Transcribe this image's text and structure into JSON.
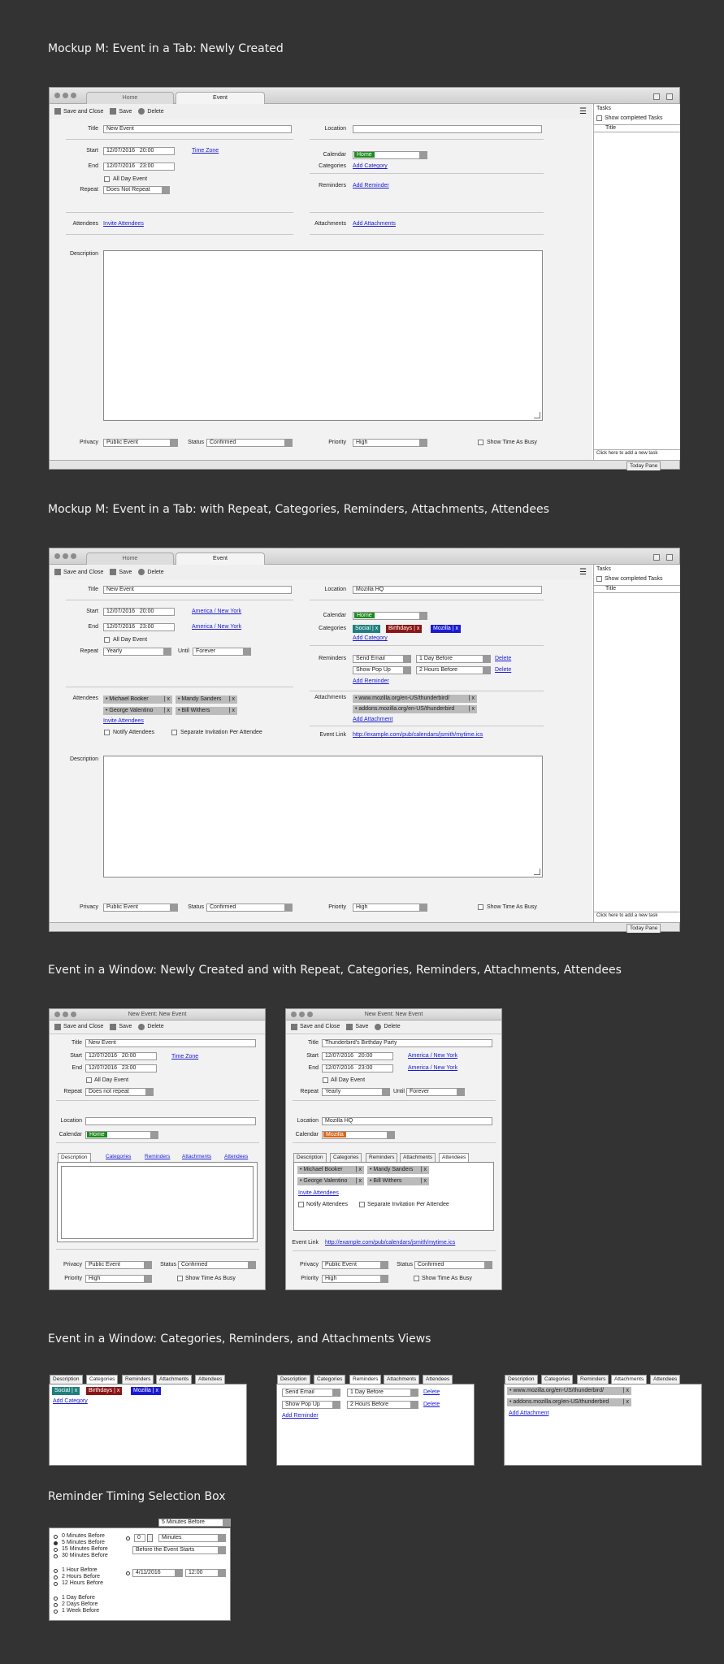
{
  "headings": [
    "Mockup M:  Event in a Tab:  Newly Created",
    "Mockup M:  Event in a Tab: with Repeat, Categories, Reminders, Attachments, Attendees",
    "Event in a Window: Newly Created and with Repeat, Categories, Reminders, Attachments, Attendees",
    "Event in a Window: Categories, Reminders, and Attachments Views",
    "Reminder Timing Selection Box"
  ],
  "tabs": {
    "home": "Home",
    "event": "Event"
  },
  "toolbar": {
    "save_close": "Save and Close",
    "save": "Save",
    "delete": "Delete"
  },
  "labels": {
    "title": "Title",
    "start": "Start",
    "end": "End",
    "repeat": "Repeat",
    "until": "Until",
    "location": "Location",
    "calendar": "Calendar",
    "categories": "Categories",
    "reminders": "Reminders",
    "attendees": "Attendees",
    "attachments": "Attachments",
    "description": "Description",
    "privacy": "Privacy",
    "status": "Status",
    "priority": "Priority",
    "event_link": "Event Link",
    "all_day": "All Day Event",
    "show_busy": "Show Time As Busy",
    "notify": "Notify Attendees",
    "separate": "Separate Invitation Per Attendee"
  },
  "values": {
    "new_event": "New Event",
    "start_date": "12/07/2016",
    "start_time": "20:00",
    "end_date": "12/07/2016",
    "end_time": "23:00",
    "time_zone": "Time Zone",
    "tz": "America / New York",
    "no_repeat": "Does Not Repeat",
    "no_repeat2": "Does not repeat",
    "yearly": "Yearly",
    "forever": "Forever",
    "home": "Home",
    "mozilla": "Mozilla",
    "mozilla_hq": "Mozilla HQ",
    "public": "Public Event",
    "confirmed": "Confirmed",
    "high": "High",
    "party": "Thunderbird's Birthday Party",
    "event_link": "http://example.com/pub/calendars/jsmith/mytime.ics"
  },
  "links": {
    "add_category": "Add Category",
    "add_reminder": "Add Reminder",
    "invite": "Invite Attendees",
    "add_attachments": "Add Attachments",
    "add_attachment": "Add Attachment",
    "delete": "Delete"
  },
  "chips": [
    {
      "label": "Social",
      "color": "#1f7f7f"
    },
    {
      "label": "Birthdays",
      "color": "#8b1515"
    },
    {
      "label": "Mozilla",
      "color": "#1a1ad6"
    }
  ],
  "attendees": [
    "• Michael Booker",
    "• Mandy Sanders",
    "• George Valentino",
    "• Bill Withers"
  ],
  "attachments": [
    "• www.mozilla.org/en-US/thunderbird/",
    "• addons.mozilla.org/en-US/thunderbird"
  ],
  "reminders": {
    "send_email": "Send Email",
    "show_popup": "Show Pop Up",
    "day_before": "1 Day Before",
    "hours_before": "2 Hours Before"
  },
  "tasks": {
    "title": "Tasks",
    "show_completed": "Show completed Tasks",
    "col_title": "Title",
    "new_task": "Click here to add a new task",
    "today_pane": "Today Pane"
  },
  "window": {
    "title": "New Event: New Event",
    "tabs": [
      "Description",
      "Categories",
      "Reminders",
      "Attachments",
      "Attendees"
    ]
  },
  "timing": {
    "header": "5 Minutes Before",
    "left": [
      "0 Minutes Before",
      "5 Minutes Before",
      "15 Minutes Before",
      "30 Minutes Before",
      "1 Hour Before",
      "2 Hours Before",
      "12 Hours Before",
      "1 Day Before",
      "2 Days Before",
      "1 Week Before"
    ],
    "num": "0",
    "unit": "Minutes",
    "rel": "Before the Event Starts",
    "date": "4/11/2016",
    "time": "12:00"
  },
  "colors": {
    "home": "#1f8a1f",
    "mozilla_cal": "#d9661a"
  }
}
